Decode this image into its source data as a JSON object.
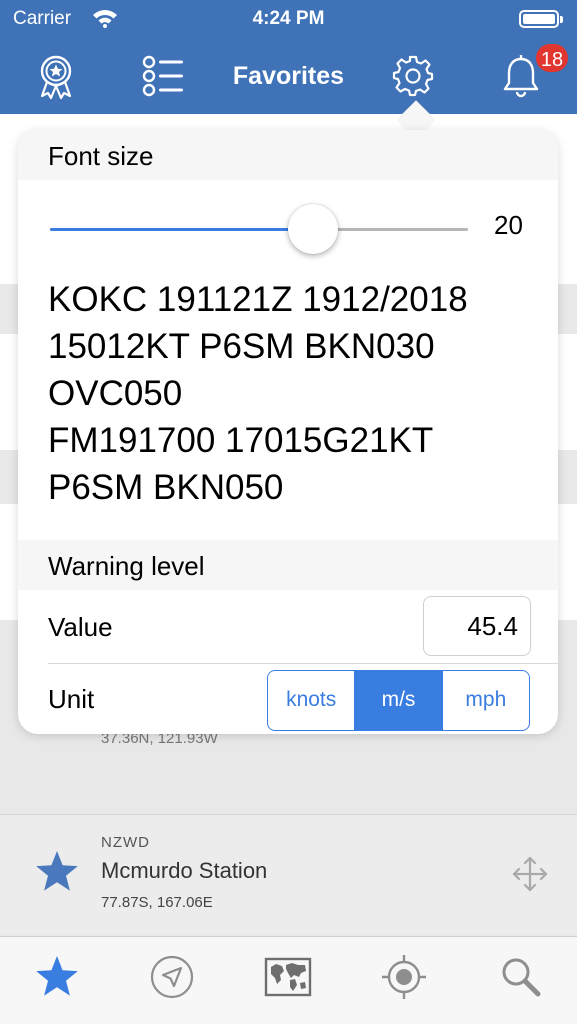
{
  "status_bar": {
    "carrier": "Carrier",
    "time": "4:24 PM"
  },
  "header": {
    "title": "Favorites",
    "notification_count": "18"
  },
  "popover": {
    "font_size": {
      "heading": "Font size",
      "slider_value": "20",
      "slider_fraction": 0.63,
      "sample_lines": [
        "KOKC 191121Z 1912/2018",
        "15012KT P6SM BKN030",
        "OVC050",
        "FM191700 17015G21KT",
        "P6SM BKN050"
      ]
    },
    "warning_level": {
      "heading": "Warning level",
      "value_label": "Value",
      "value": "45.4",
      "unit_label": "Unit",
      "units": [
        "knots",
        "m/s",
        "mph"
      ],
      "selected_unit": "m/s"
    }
  },
  "background": {
    "partial_coord": "37.36N, 121.93W",
    "favorite": {
      "code": "NZWD",
      "name": "Mcmurdo Station",
      "coord": "77.87S, 167.06E"
    }
  },
  "colors": {
    "header": "#3f72b7",
    "accent": "#3a7de0",
    "badge": "#e0362f"
  }
}
